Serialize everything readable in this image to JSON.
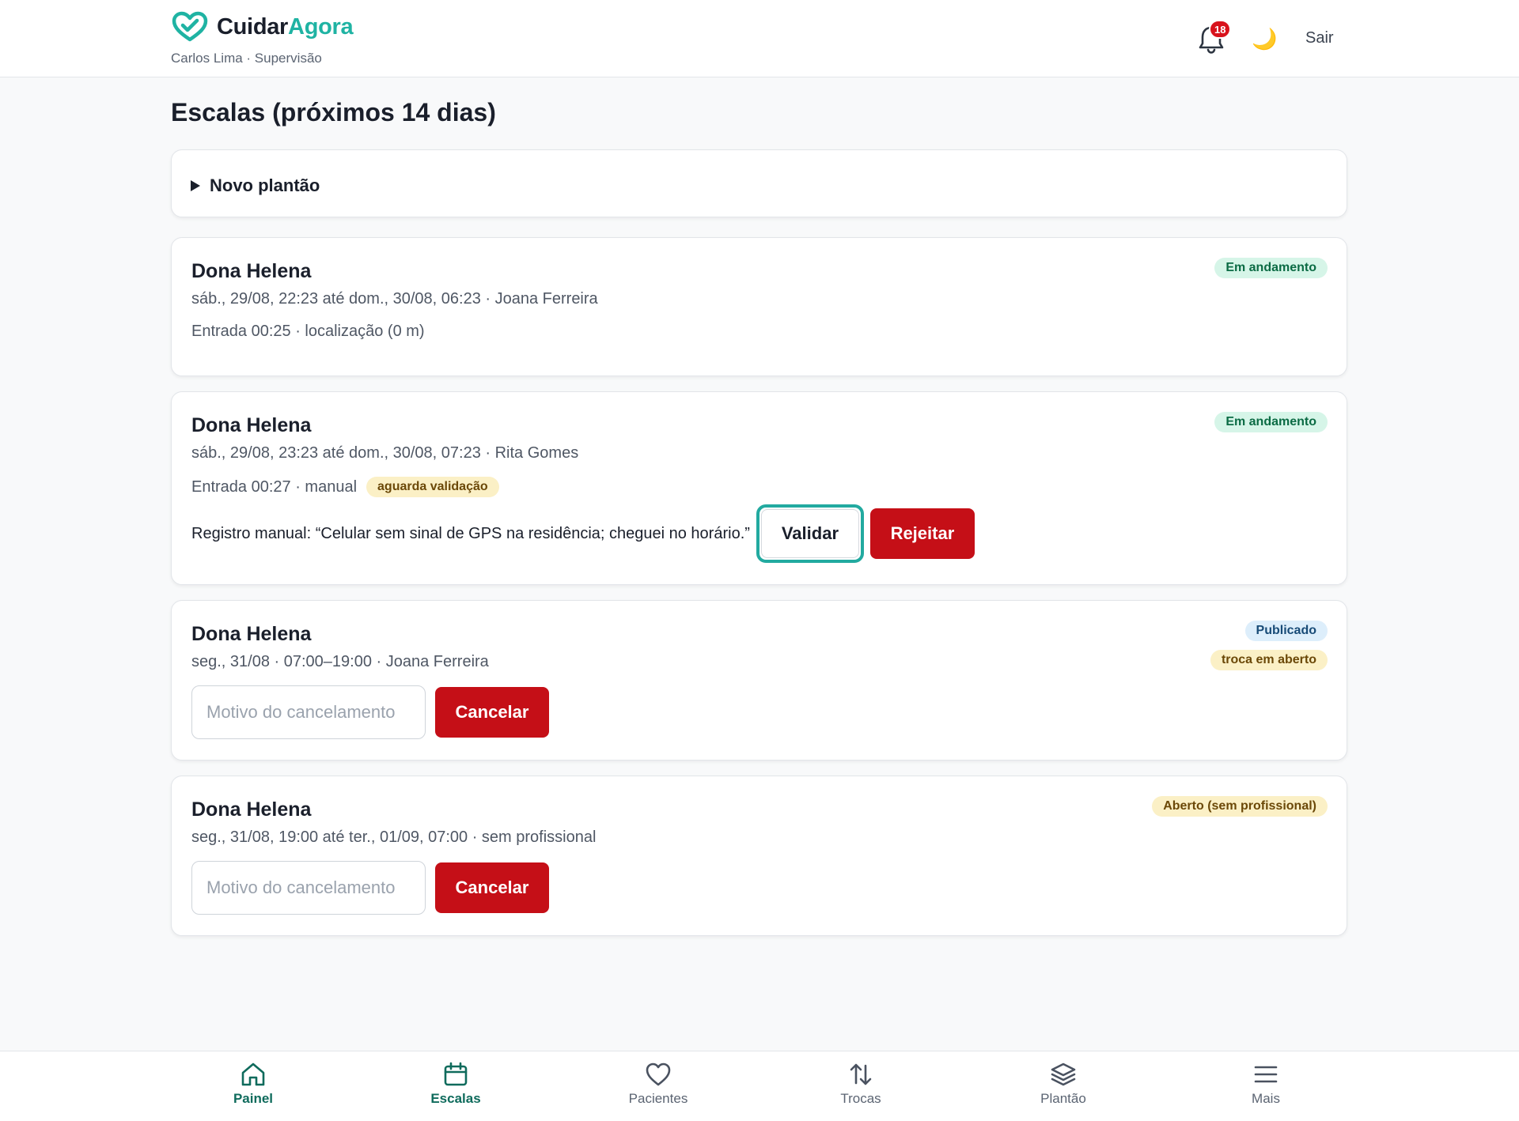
{
  "header": {
    "brand_part1": "Cuidar",
    "brand_part2": "Agora",
    "user_line": "Carlos Lima · Supervisão",
    "notifications_count": "18",
    "theme_toggle": "🌙",
    "logout_label": "Sair"
  },
  "page_title": "Escalas (próximos 14 dias)",
  "new_shift_label": "Novo plantão",
  "shifts": [
    {
      "patient": "Dona Helena",
      "time": "sáb., 29/08, 22:23 até dom., 30/08, 06:23 · Joana Ferreira",
      "status": "Em andamento",
      "entry": "Entrada 00:25 · localização (0 m)"
    },
    {
      "patient": "Dona Helena",
      "time": "sáb., 29/08, 23:23 até dom., 30/08, 07:23 · Rita Gomes",
      "status": "Em andamento",
      "entry": "Entrada 00:27 · manual",
      "entry_badge": "aguarda validação",
      "manual_note": "Registro manual: “Celular sem sinal de GPS na residência; cheguei no horário.”",
      "validate_label": "Validar",
      "reject_label": "Rejeitar"
    },
    {
      "patient": "Dona Helena",
      "time": "seg., 31/08 · 07:00–19:00 · Joana Ferreira",
      "status": "Publicado",
      "status2": "troca em aberto",
      "cancel_placeholder": "Motivo do cancelamento",
      "cancel_label": "Cancelar"
    },
    {
      "patient": "Dona Helena",
      "time": "seg., 31/08, 19:00 até ter., 01/09, 07:00 · sem profissional",
      "status": "Aberto (sem profissional)",
      "cancel_placeholder": "Motivo do cancelamento",
      "cancel_label": "Cancelar"
    }
  ],
  "nav": [
    {
      "label": "Painel",
      "icon": "home-icon",
      "active": true
    },
    {
      "label": "Escalas",
      "icon": "calendar-icon",
      "active": true
    },
    {
      "label": "Pacientes",
      "icon": "heart-icon",
      "active": false
    },
    {
      "label": "Trocas",
      "icon": "swap-arrows-icon",
      "active": false
    },
    {
      "label": "Plantão",
      "icon": "layers-icon",
      "active": false
    },
    {
      "label": "Mais",
      "icon": "menu-icon",
      "active": false
    }
  ],
  "colors": {
    "accent": "#1fb3a3",
    "danger": "#c50f17",
    "active_nav": "#0f6b5c"
  }
}
